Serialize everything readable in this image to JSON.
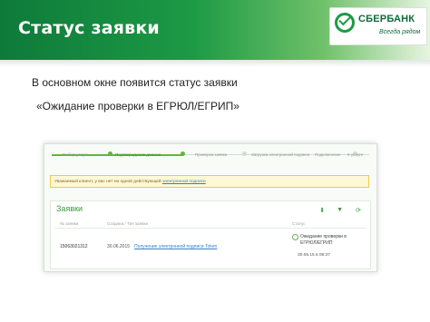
{
  "header": {
    "title": "Статус заявки",
    "logo_name": "СБЕРБАНК",
    "logo_tagline": "Всегда рядом"
  },
  "body": {
    "line1": "В основном окне появится статус заявки",
    "line2": "«Ожидание проверки в ЕГРЮЛ/ЕГРИП»"
  },
  "screenshot": {
    "steps": [
      "Выбор услуги",
      "Подтверждение данных",
      "Проверка заявки",
      "Загрузка электронной подписи",
      "Подключение",
      "К услуге"
    ],
    "active_steps": 2,
    "notice_text": "Уважаемый клиент, у вас нет ни одной действующей ",
    "notice_link": "электронной подписи",
    "panel_title": "Заявки",
    "columns": [
      "№ заявки",
      "Создана / Тип заявки",
      "Статус"
    ],
    "row": {
      "id": "15063021312",
      "date": "30.06.2015",
      "type": "Получение электронной подписи Token",
      "status": "Ожидание проверки в ЕГРЮЛ/ЕГРИП",
      "status_time": "30.06.15 в 08:37"
    },
    "colors": {
      "accent_green": "#1d9a45",
      "link_blue": "#3a7cc6",
      "notice_bg": "#fff8d8"
    }
  }
}
